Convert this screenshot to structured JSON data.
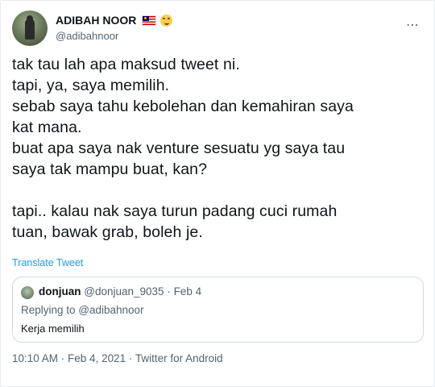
{
  "author": {
    "display_name": "ADIBAH NOOR",
    "handle": "@adibahnoor",
    "badges": [
      "malaysia-flag-icon",
      "smiling-devil-emoji-icon"
    ]
  },
  "tweet": {
    "text": "tak tau lah apa maksud tweet ni.\ntapi, ya, saya memilih.\nsebab saya tahu kebolehan dan kemahiran saya\nkat mana.\nbuat apa saya nak venture sesuatu yg saya tau\nsaya tak mampu buat, kan?\n\ntapi.. kalau nak saya turun padang cuci rumah\ntuan, bawak grab, boleh je.",
    "translate_label": "Translate Tweet"
  },
  "quoted": {
    "name": "donjuan",
    "handle": "@donjuan_9035",
    "separator": " · ",
    "date": "Feb 4",
    "replying_prefix": "Replying to ",
    "replying_to": "@adibahnoor",
    "text": "Kerja memilih"
  },
  "meta": {
    "time": "10:10 AM",
    "separator": " · ",
    "date": "Feb 4, 2021",
    "source": "Twitter for Android"
  },
  "more_icon": "⋯",
  "colors": {
    "link": "#1d9bf0",
    "secondary": "#536471",
    "border": "#cfd9de"
  }
}
